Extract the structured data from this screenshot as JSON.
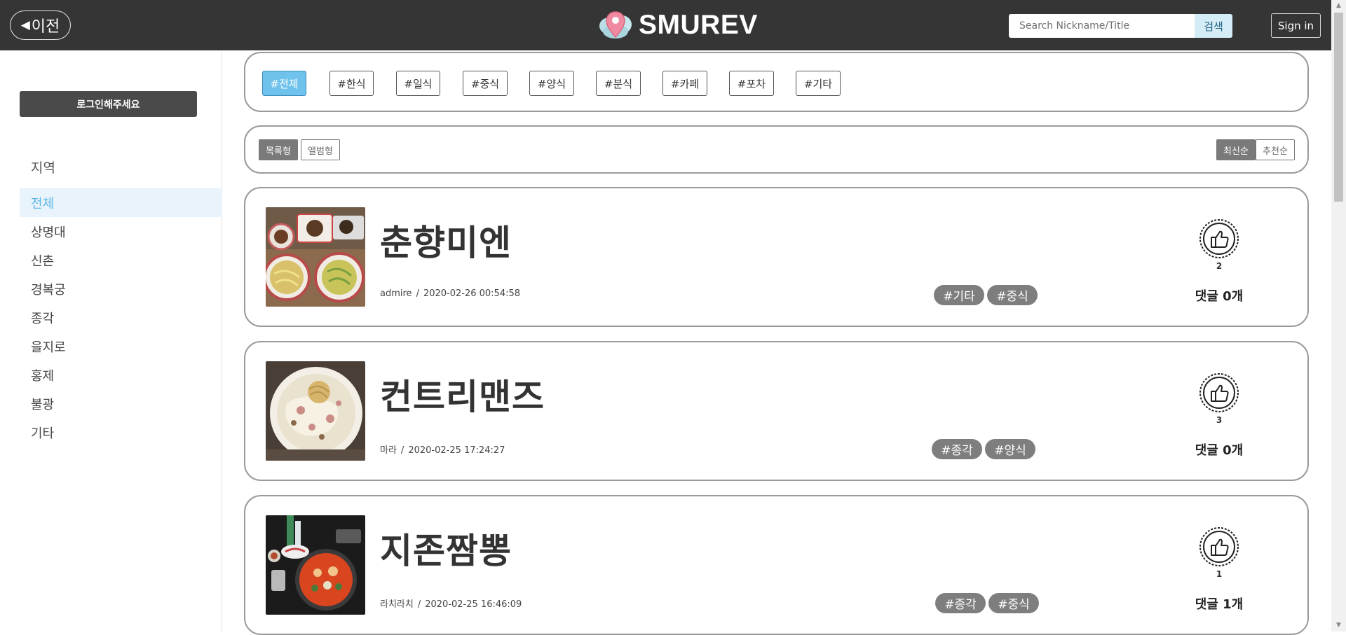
{
  "header": {
    "back_label": "이전",
    "logo_text": "SMUREV",
    "search_placeholder": "Search Nickname/Title",
    "search_button": "검색",
    "signin_button": "Sign in"
  },
  "sidebar": {
    "login_button": "로그인해주세요",
    "region_title": "지역",
    "regions": [
      "전체",
      "상명대",
      "신촌",
      "경복궁",
      "종각",
      "을지로",
      "홍제",
      "불광",
      "기타"
    ],
    "active_region": "전체"
  },
  "categories": {
    "items": [
      "#전체",
      "#한식",
      "#일식",
      "#중식",
      "#양식",
      "#분식",
      "#카페",
      "#포차",
      "#기타"
    ],
    "active": "#전체"
  },
  "view_options": {
    "list_view": "목록형",
    "album_view": "앨범형",
    "active_view": "목록형",
    "sort_latest": "최신순",
    "sort_recommend": "추천순",
    "active_sort": "최신순"
  },
  "posts": [
    {
      "title": "춘향미엔",
      "author": "admire",
      "separator": "/",
      "date": "2020-02-26 00:54:58",
      "tags": [
        "#기타",
        "#중식"
      ],
      "likes": "2",
      "comments": "댓글 0개"
    },
    {
      "title": "컨트리맨즈",
      "author": "마라",
      "separator": "/",
      "date": "2020-02-25 17:24:27",
      "tags": [
        "#종각",
        "#양식"
      ],
      "likes": "3",
      "comments": "댓글 0개"
    },
    {
      "title": "지존짬뽕",
      "author": "라치라치",
      "separator": "/",
      "date": "2020-02-25 16:46:09",
      "tags": [
        "#종각",
        "#중식"
      ],
      "likes": "1",
      "comments": "댓글 1개"
    }
  ],
  "colors": {
    "header_bg": "#353535",
    "accent": "#6ec2ec",
    "tag_bg": "#7e7e7e"
  }
}
